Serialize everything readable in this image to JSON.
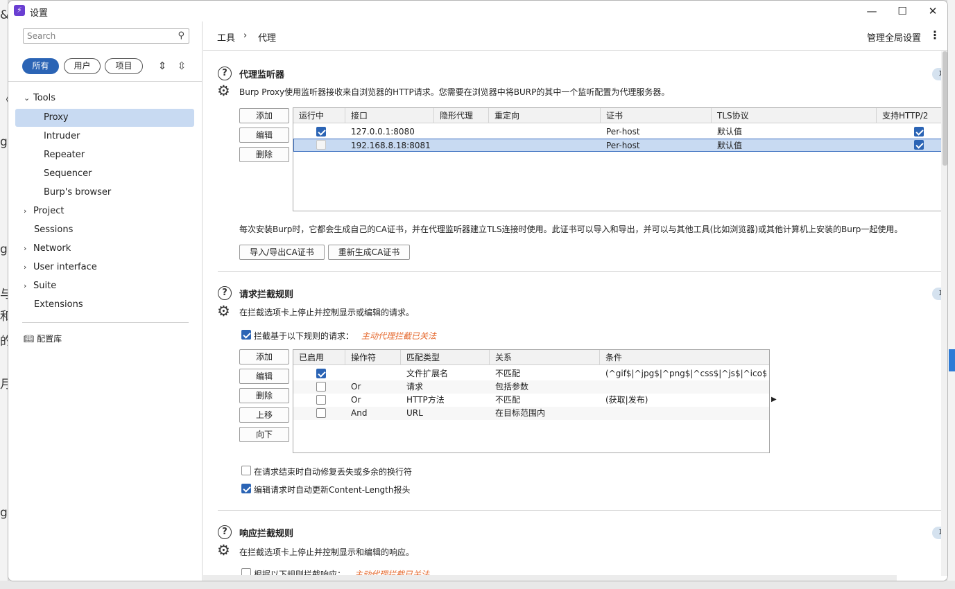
{
  "window": {
    "title": "设置"
  },
  "sidebar": {
    "search_placeholder": "Search",
    "filters": [
      "所有",
      "用户",
      "项目"
    ],
    "tree": [
      {
        "label": "Tools",
        "expanded": true
      },
      {
        "label": "Proxy"
      },
      {
        "label": "Intruder"
      },
      {
        "label": "Repeater"
      },
      {
        "label": "Sequencer"
      },
      {
        "label": "Burp's browser"
      },
      {
        "label": "Project"
      },
      {
        "label": "Sessions"
      },
      {
        "label": "Network"
      },
      {
        "label": "User interface"
      },
      {
        "label": "Suite"
      },
      {
        "label": "Extensions"
      }
    ],
    "library": "配置库"
  },
  "breadcrumb": {
    "root": "工具",
    "sep": "›",
    "current": "代理"
  },
  "header": {
    "global_settings": "管理全局设置"
  },
  "listeners": {
    "title": "代理监听器",
    "badge": "项",
    "desc": "Burp Proxy使用监听器接收来自浏览器的HTTP请求。您需要在浏览器中将BURP的其中一个监听配置为代理服务器。",
    "buttons": [
      "添加",
      "编辑",
      "删除"
    ],
    "columns": [
      "运行中",
      "接口",
      "隐形代理",
      "重定向",
      "证书",
      "TLS协议",
      "支持HTTP/2"
    ],
    "rows": [
      {
        "running": true,
        "iface": "127.0.0.1:8080",
        "invisible": "",
        "redirect": "",
        "cert": "Per-host",
        "tls": "默认值",
        "http2": true
      },
      {
        "running": false,
        "iface": "192.168.8.18:8081",
        "invisible": "",
        "redirect": "",
        "cert": "Per-host",
        "tls": "默认值",
        "http2": true
      }
    ],
    "ca_desc": "每次安装Burp时，它都会生成自己的CA证书，并在代理监听器建立TLS连接时使用。此证书可以导入和导出，并可以与其他工具(比如浏览器)或其他计算机上安装的Burp一起使用。",
    "ca_buttons": [
      "导入/导出CA证书",
      "重新生成CA证书"
    ]
  },
  "request_rules": {
    "title": "请求拦截规则",
    "badge": "项",
    "desc": "在拦截选项卡上停止并控制显示或编辑的请求。",
    "enable_label": "拦截基于以下规则的请求：",
    "status": "主动代理拦截已关法",
    "buttons": [
      "添加",
      "编辑",
      "删除",
      "上移",
      "向下"
    ],
    "columns": [
      "已启用",
      "操作符",
      "匹配类型",
      "关系",
      "条件"
    ],
    "rows": [
      {
        "enabled": true,
        "op": "",
        "type": "文件扩展名",
        "rel": "不匹配",
        "cond": "(^gif$|^jpg$|^png$|^css$|^js$|^ico$|..."
      },
      {
        "enabled": false,
        "op": "Or",
        "type": "请求",
        "rel": "包括参数",
        "cond": ""
      },
      {
        "enabled": false,
        "op": "Or",
        "type": "HTTP方法",
        "rel": "不匹配",
        "cond": "(获取|发布)"
      },
      {
        "enabled": false,
        "op": "And",
        "type": "URL",
        "rel": "在目标范围内",
        "cond": ""
      }
    ],
    "opt1": "在请求结束时自动修复丢失或多余的换行符",
    "opt2": "编辑请求时自动更新Content-Length报头"
  },
  "response_rules": {
    "title": "响应拦截规则",
    "badge": "项",
    "desc": "在拦截选项卡上停止并控制显示和编辑的响应。",
    "enable_label": "根据以下规则拦截响应：",
    "status": "主动代理拦截已关法"
  },
  "colors": {
    "accent": "#2b64b5",
    "selection": "#c8daf2",
    "warning": "#e5692e"
  }
}
